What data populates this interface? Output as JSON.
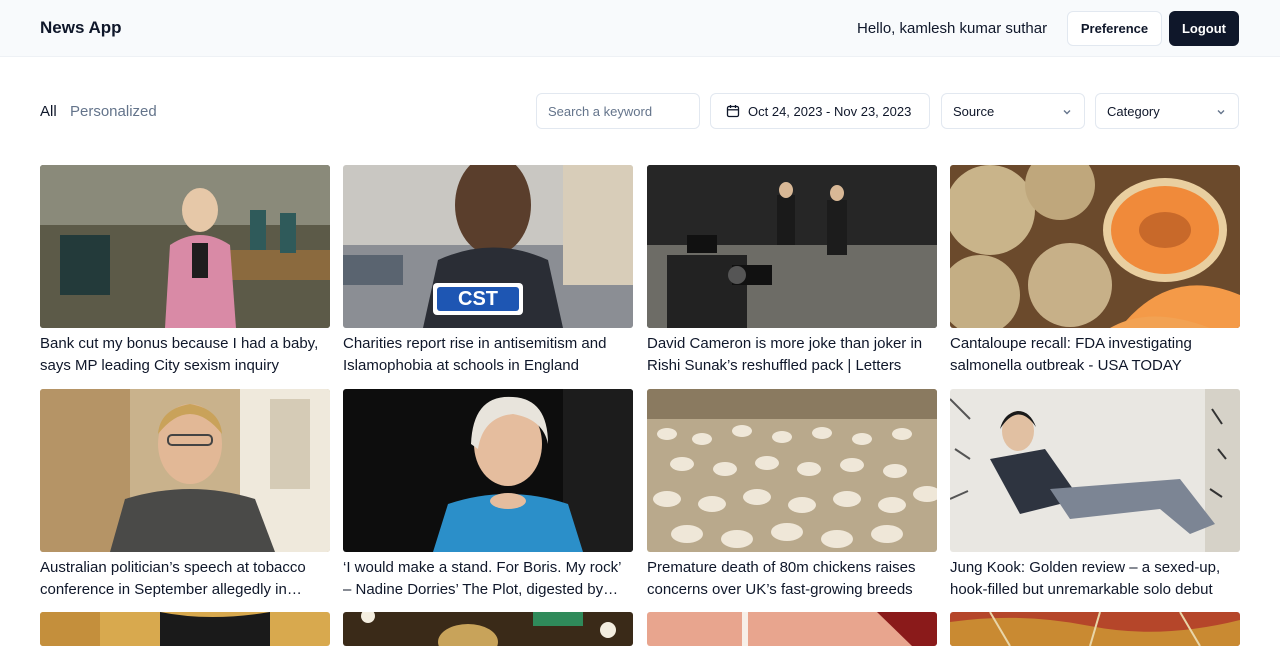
{
  "header": {
    "brand": "News App",
    "greeting": "Hello, kamlesh kumar suthar",
    "preference_label": "Preference",
    "logout_label": "Logout"
  },
  "filters": {
    "tabs": [
      {
        "label": "All",
        "active": true
      },
      {
        "label": "Personalized",
        "active": false
      }
    ],
    "search_placeholder": "Search a keyword",
    "date_range": "Oct 24, 2023 - Nov 23, 2023",
    "source_label": "Source",
    "category_label": "Category",
    "icons": {
      "date": "calendar-icon",
      "dropdown": "chevron-down-icon"
    }
  },
  "articles": [
    {
      "title": "Bank cut my bonus because I had a baby, says MP leading City sexism inquiry",
      "image": "woman-in-pink-jacket-committee-room"
    },
    {
      "title": "Charities report rise in antisemitism and Islamophobia at schools in England",
      "image": "cst-security-officer-back"
    },
    {
      "title": "David Cameron is more joke than joker in Rishi Sunak’s reshuffled pack | Letters",
      "image": "photographers-at-downing-street"
    },
    {
      "title": "Cantaloupe recall: FDA investigating salmonella outbreak - USA TODAY",
      "image": "cantaloupe-melons"
    },
    {
      "title": "Australian politician’s speech at tobacco conference in September allegedly in Australia’s breach of WHO treaty",
      "image": "woman-with-glasses-office"
    },
    {
      "title": "‘I would make a stand. For Boris. My rock’ – Nadine Dorries’ The Plot, digested by John Crace",
      "image": "blonde-woman-blue-top"
    },
    {
      "title": "Premature death of 80m chickens raises concerns over UK’s fast-growing breeds",
      "image": "chicken-shed"
    },
    {
      "title": "Jung Kook: Golden review – a sexed-up, hook-filled but unremarkable solo debut",
      "image": "man-in-denim-reclining"
    },
    {
      "title": "",
      "image": "partial-image-1"
    },
    {
      "title": "",
      "image": "partial-image-2"
    },
    {
      "title": "",
      "image": "partial-image-3"
    },
    {
      "title": "",
      "image": "partial-image-4"
    }
  ]
}
